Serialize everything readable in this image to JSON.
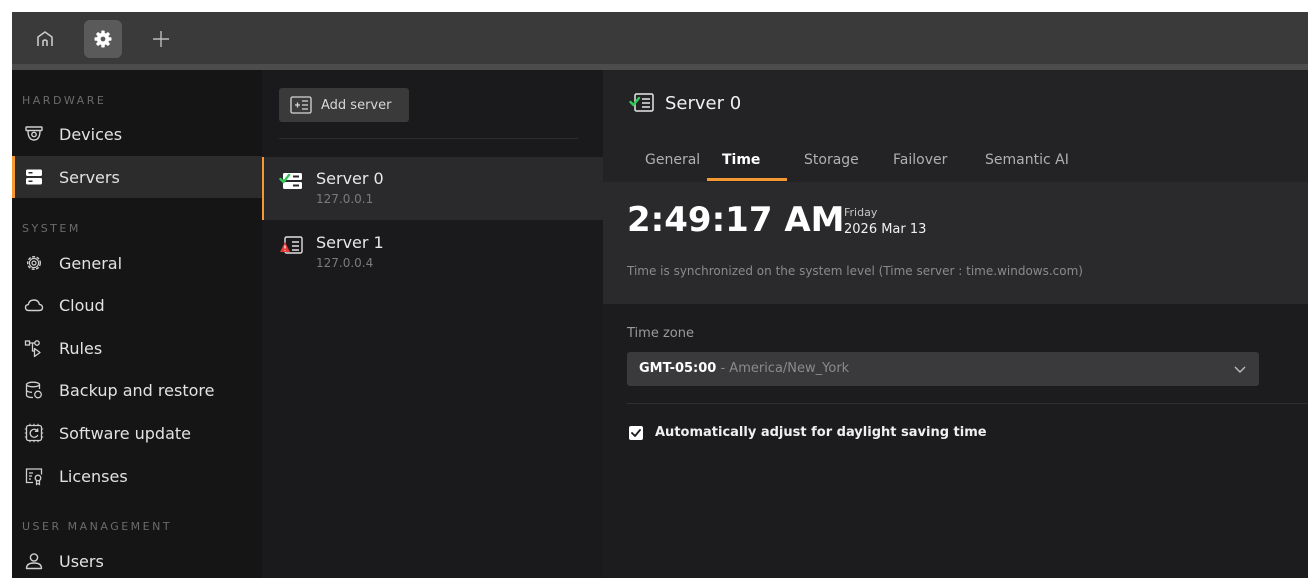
{
  "titlebar": {
    "tabs": [
      {
        "icon": "home-icon"
      },
      {
        "icon": "gear-icon"
      },
      {
        "icon": "plus-icon"
      }
    ]
  },
  "sidebar": {
    "sections": [
      {
        "title": "HARDWARE",
        "items": [
          {
            "label": "Devices",
            "icon": "camera-icon"
          },
          {
            "label": "Servers",
            "icon": "server-icon",
            "active": true
          }
        ]
      },
      {
        "title": "SYSTEM",
        "items": [
          {
            "label": "General",
            "icon": "gear-icon"
          },
          {
            "label": "Cloud",
            "icon": "cloud-icon"
          },
          {
            "label": "Rules",
            "icon": "rules-icon"
          },
          {
            "label": "Backup and restore",
            "icon": "database-icon"
          },
          {
            "label": "Software update",
            "icon": "update-icon"
          },
          {
            "label": "Licenses",
            "icon": "license-icon"
          }
        ]
      },
      {
        "title": "USER MANAGEMENT",
        "items": [
          {
            "label": "Users",
            "icon": "user-icon"
          }
        ]
      }
    ]
  },
  "server_list": {
    "add_label": "Add server",
    "servers": [
      {
        "name": "Server 0",
        "ip": "127.0.0.1",
        "status": "online",
        "active": true
      },
      {
        "name": "Server 1",
        "ip": "127.0.0.4",
        "status": "warning"
      }
    ]
  },
  "detail": {
    "title": "Server 0",
    "tabs": [
      "General",
      "Time",
      "Storage",
      "Failover",
      "Semantic AI"
    ],
    "active_tab": "Time",
    "time": "2:49:17 AM",
    "day_of_week": "Friday",
    "date": "2026 Mar 13",
    "sync_note": "Time is synchronized on the system level (Time server : time.windows.com)",
    "timezone_label": "Time zone",
    "timezone_value": "GMT-05:00",
    "timezone_name": " - America/New_York",
    "dst_label": "Automatically adjust for daylight saving time",
    "dst_checked": true
  },
  "colors": {
    "accent": "#f59a32",
    "online": "#34c759",
    "warning": "#e53935"
  }
}
